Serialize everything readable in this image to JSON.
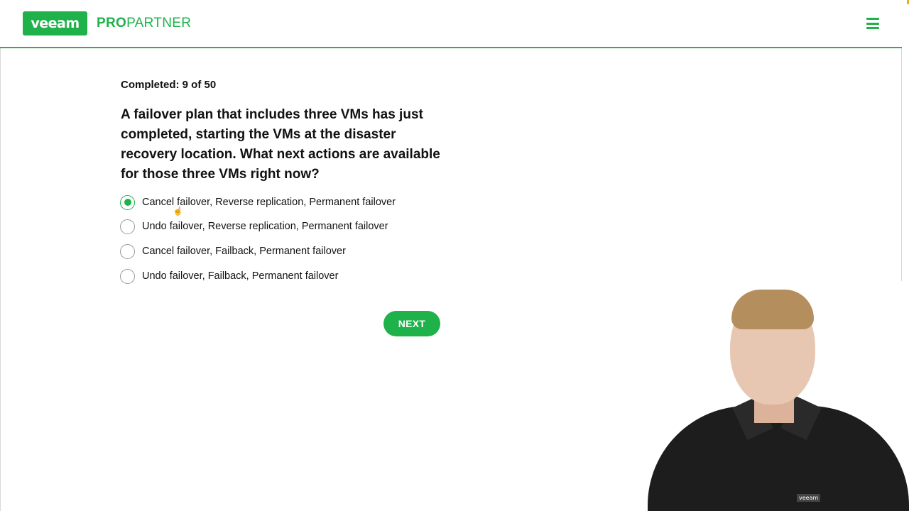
{
  "header": {
    "logo_text": "veeam",
    "brand_pro": "PRO",
    "brand_partner": "PARTNER",
    "menu_icon": "hamburger-menu-icon"
  },
  "quiz": {
    "progress": "Completed: 9 of 50",
    "question": "A failover plan that includes three VMs has just completed, starting the VMs at the disaster recovery location. What next actions are available for those three VMs right now?",
    "options": [
      {
        "label": "Cancel failover, Reverse replication, Permanent failover",
        "selected": true
      },
      {
        "label": "Undo failover, Reverse replication, Permanent failover",
        "selected": false
      },
      {
        "label": "Cancel failover, Failback, Permanent failover",
        "selected": false
      },
      {
        "label": "Undo failover, Failback, Permanent failover",
        "selected": false
      }
    ],
    "next_label": "NEXT"
  },
  "webcam": {
    "shirt_logo": "veeam"
  },
  "colors": {
    "accent": "#1fb14a",
    "header_border": "#3aab48"
  }
}
